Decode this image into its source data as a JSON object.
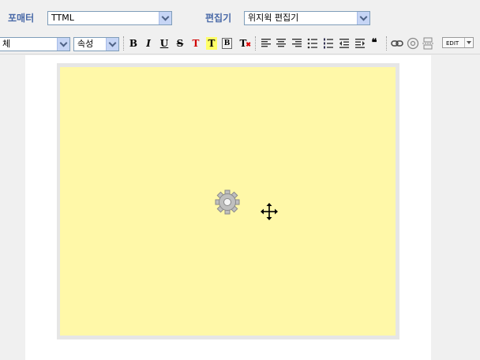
{
  "header": {
    "formatter_label": "포매터",
    "formatter_value": "TTML",
    "editor_label": "편집기",
    "editor_value": "위지윅 편집기"
  },
  "toolbar": {
    "font_value": "체",
    "attr_value": "속성",
    "bold": "B",
    "italic": "I",
    "underline": "U",
    "strike": "S",
    "text_color": "T",
    "highlight": "T",
    "box": "B",
    "clear_format": "T",
    "quote": "❝",
    "edit_label": "EDIT"
  },
  "colors": {
    "canvas": "#fff8a8",
    "label": "#4a6aa8",
    "text_color_red": "#d00000",
    "highlight_yellow": "#ffff66"
  },
  "icons": [
    "align-left-icon",
    "align-center-icon",
    "align-right-icon",
    "bulleted-list-icon",
    "numbered-list-icon",
    "outdent-icon",
    "indent-icon",
    "quote-icon",
    "link-icon",
    "media-icon",
    "page-break-icon",
    "gear-icon",
    "move-cursor-icon"
  ]
}
